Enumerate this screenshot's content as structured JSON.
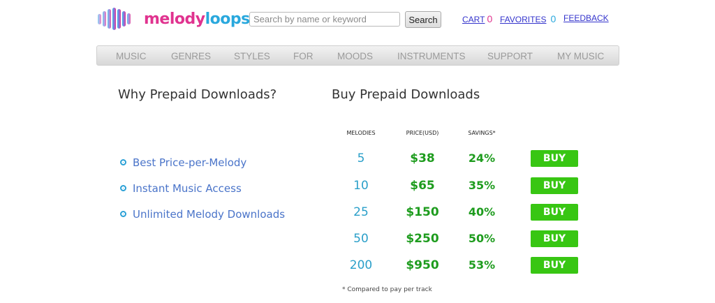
{
  "brand": {
    "part1": "melody",
    "part2": "loops"
  },
  "search": {
    "placeholder": "Search by name or keyword",
    "value": "",
    "button_label": "Search"
  },
  "toplinks": {
    "cart_label": "CART",
    "cart_count": "0",
    "favorites_label": "FAVORITES",
    "favorites_count": "0",
    "feedback_label": "FEEDBACK"
  },
  "nav": [
    "MUSIC",
    "GENRES",
    "STYLES",
    "FOR",
    "MOODS",
    "INSTRUMENTS",
    "SUPPORT",
    "MY MUSIC"
  ],
  "why": {
    "heading": "Why Prepaid Downloads?",
    "items": [
      "Best Price-per-Melody",
      "Instant Music Access",
      "Unlimited Melody Downloads"
    ]
  },
  "buy": {
    "heading": "Buy Prepaid Downloads",
    "columns": {
      "melodies": "MELODIES",
      "price": "PRICE(USD)",
      "savings": "SAVINGS*"
    },
    "rows": [
      {
        "melodies": "5",
        "price": "$38",
        "savings": "24%",
        "button": "BUY"
      },
      {
        "melodies": "10",
        "price": "$65",
        "savings": "35%",
        "button": "BUY"
      },
      {
        "melodies": "25",
        "price": "$150",
        "savings": "40%",
        "button": "BUY"
      },
      {
        "melodies": "50",
        "price": "$250",
        "savings": "50%",
        "button": "BUY"
      },
      {
        "melodies": "200",
        "price": "$950",
        "savings": "53%",
        "button": "BUY"
      }
    ],
    "footnote": "* Compared to pay per track"
  },
  "colors": {
    "brand_pink": "#e0338f",
    "brand_blue": "#29a8dd",
    "buy_green": "#38c613",
    "price_green": "#1e9c1e"
  }
}
